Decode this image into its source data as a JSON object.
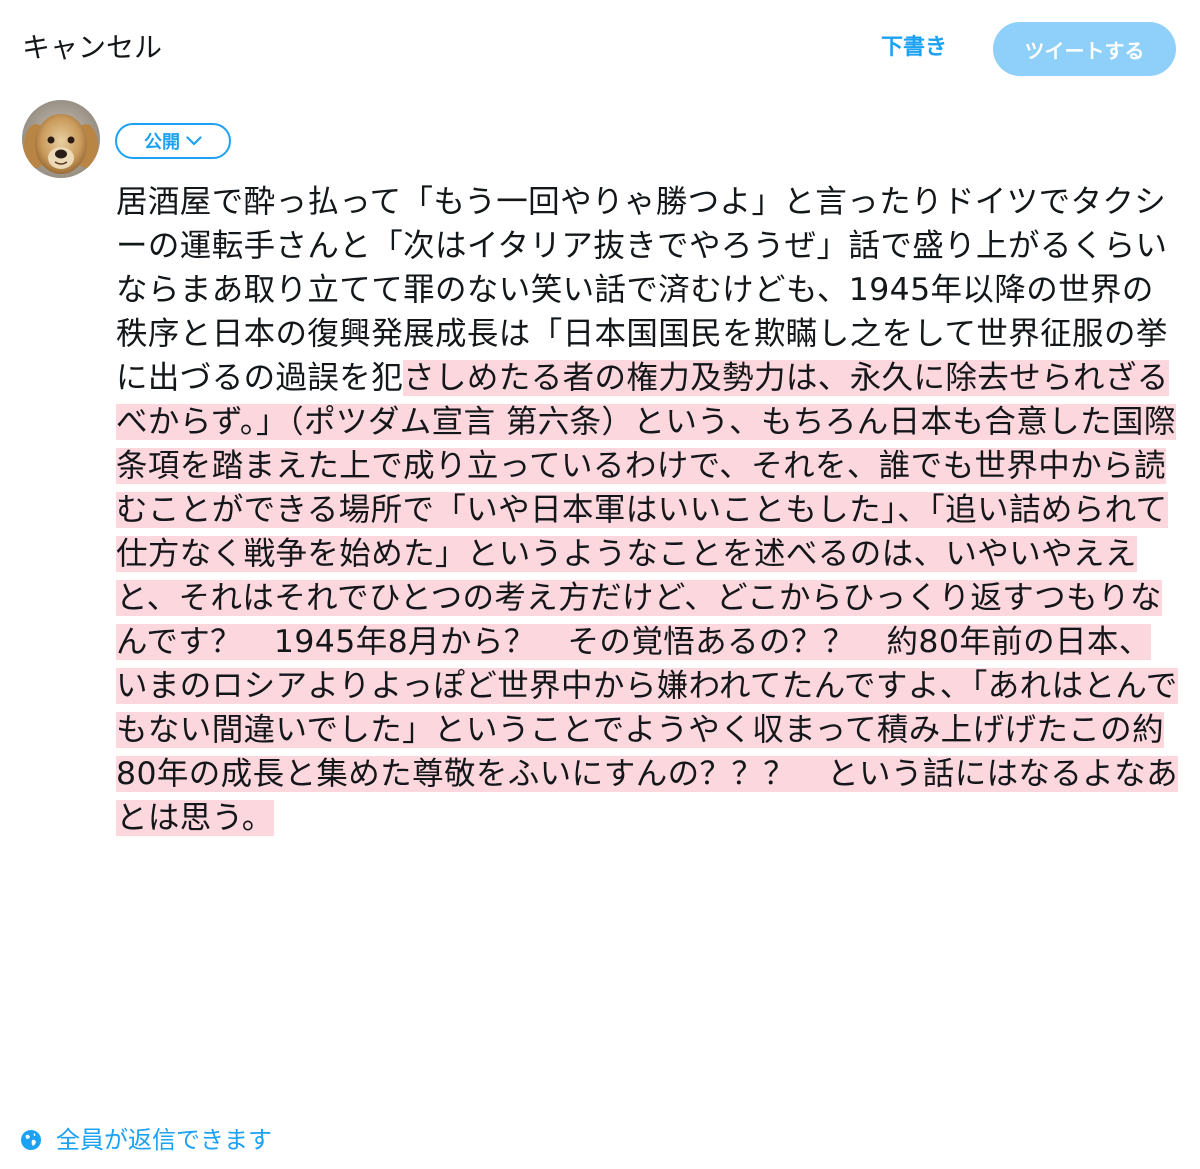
{
  "header": {
    "cancel_label": "キャンセル",
    "draft_label": "下書き",
    "tweet_label": "ツイートする"
  },
  "composer": {
    "avatar_icon": "golden-retriever-avatar",
    "audience_label": "公開",
    "text_plain": "居酒屋で酔っ払って「もう一回やりゃ勝つよ」と言ったりドイツでタクシーの運転手さんと「次はイタリア抜きでやろうぜ」話で盛り上がるくらいならまあ取り立てて罪のない笑い話で済むけども、1945年以降の世界の秩序と日本の復興発展成長は「日本国国民を欺瞞し之をして世界征服の挙に出づるの過誤を犯",
    "text_highlighted": "さしめたる者の権力及勢力は、永久に除去せられざるべからず。」（ポツダム宣言 第六条）という、もちろん日本も合意した国際条項を踏まえた上で成り立っているわけで、それを、誰でも世界中から読むことができる場所で「いや日本軍はいいこともした」、「追い詰められて仕方なく戦争を始めた」というようなことを述べるのは、いやいやええと、それはそれでひとつの考え方だけど、どこからひっくり返すつもりなんです？　1945年8月から？　その覚悟あるの？？　約80年前の日本、いまのロシアよりよっぽど世界中から嫌われてたんですよ、「あれはとんでもない間違いでした」ということでようやく収まって積み上げげたこの約80年の成長と集めた尊敬をふいにすんの？？？　という話にはなるよなあとは思う。"
  },
  "footer": {
    "reply_icon": "globe-icon",
    "reply_label": "全員が返信できます"
  },
  "colors": {
    "accent": "#1da1f2",
    "tweet_button_disabled": "#8ed0f9",
    "highlight": "#fcd7de",
    "text": "#14171a"
  }
}
